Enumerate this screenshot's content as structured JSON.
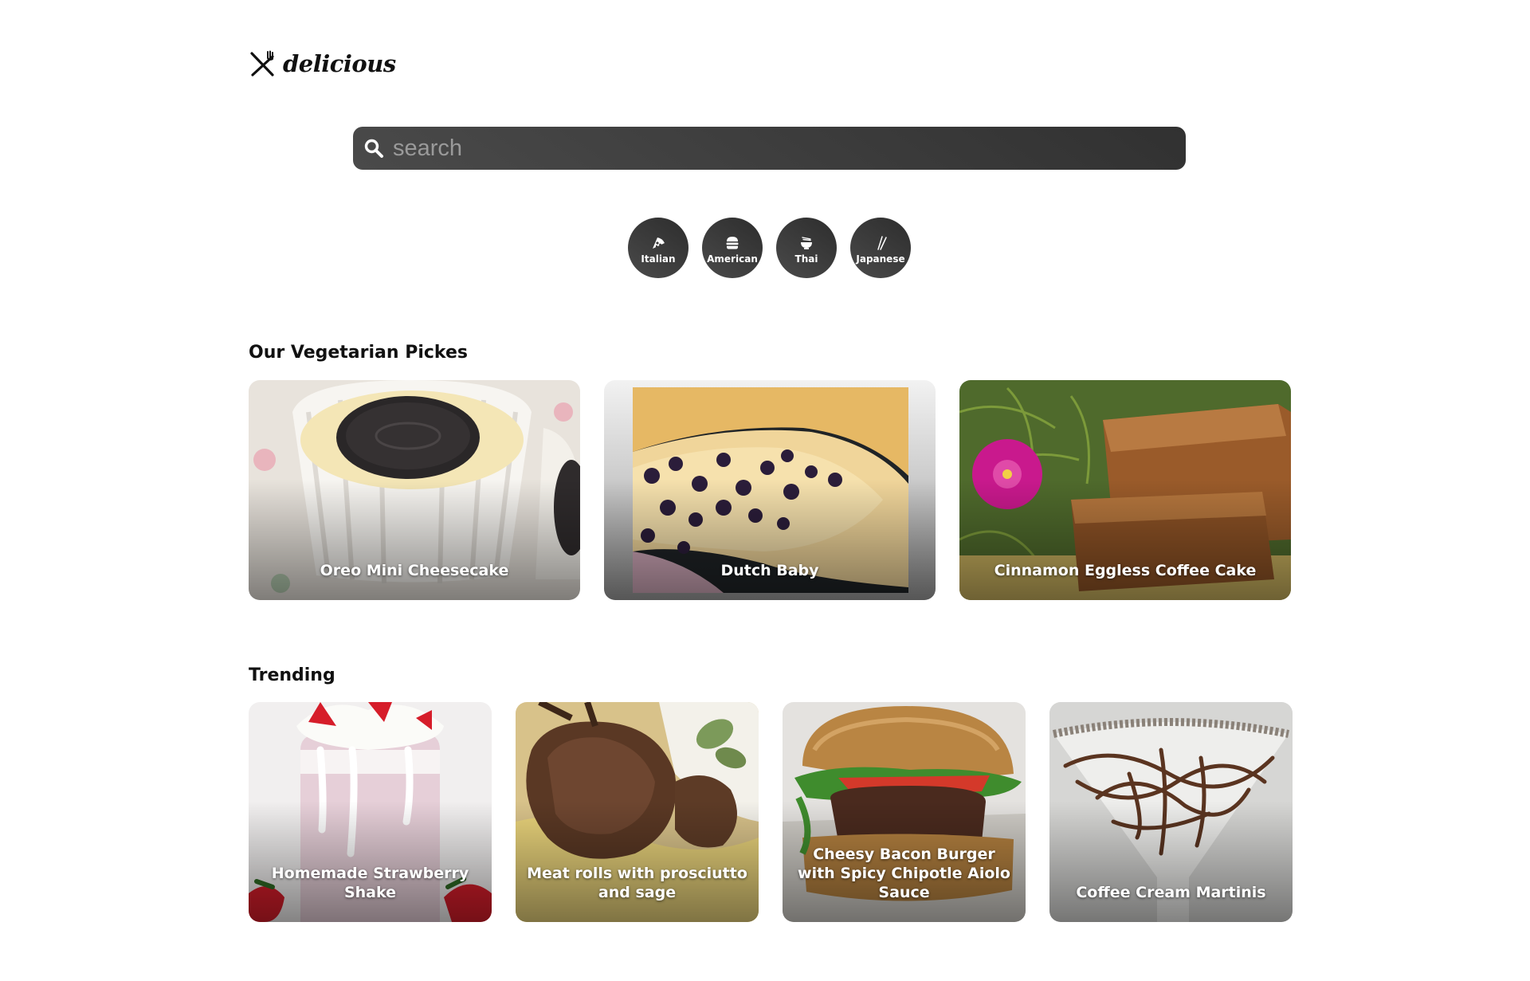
{
  "brand": {
    "name": "delicious",
    "icon": "fork-knife-icon"
  },
  "search": {
    "placeholder": "search",
    "value": "",
    "icon": "search-icon"
  },
  "categories": [
    {
      "label": "Italian",
      "icon": "pizza-icon"
    },
    {
      "label": "American",
      "icon": "burger-icon"
    },
    {
      "label": "Thai",
      "icon": "noodle-bowl-icon"
    },
    {
      "label": "Japanese",
      "icon": "chopsticks-icon"
    }
  ],
  "vegetarian": {
    "title": "Our Vegetarian Pickes",
    "items": [
      {
        "title": "Oreo Mini Cheesecake"
      },
      {
        "title": "Dutch Baby"
      },
      {
        "title": "Cinnamon Eggless Coffee Cake"
      }
    ]
  },
  "trending": {
    "title": "Trending",
    "items": [
      {
        "title": "Homemade Strawberry Shake"
      },
      {
        "title": "Meat rolls with prosciutto and sage"
      },
      {
        "title": "Cheesy Bacon Burger with Spicy Chipotle Aiolo Sauce"
      },
      {
        "title": "Coffee Cream Martinis"
      }
    ]
  },
  "colors": {
    "dark_surface": "#3a3a3a",
    "text": "#111111",
    "card_text": "#ffffff"
  }
}
